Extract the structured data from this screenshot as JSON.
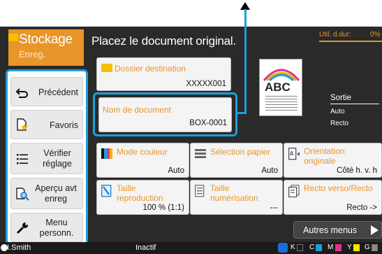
{
  "mode": {
    "title": "Stockage",
    "subtitle": "Enreg."
  },
  "side_menu": {
    "items": [
      {
        "label": "Précédent",
        "icon": "back-arrow-icon"
      },
      {
        "label": "Favoris",
        "icon": "favorite-star-icon"
      },
      {
        "label": "Vérifier réglage",
        "icon": "list-icon"
      },
      {
        "label": "Aperçu avt enreg",
        "icon": "preview-magnifier-icon"
      },
      {
        "label": "Menu personn.",
        "icon": "wrench-icon"
      }
    ]
  },
  "main": {
    "title": "Placez le document original.",
    "util_label": "Util. d.dur:",
    "util_value": "0%",
    "folder": {
      "label": "Dossier destination",
      "value": "XXXXX001",
      "icon": "folder-icon"
    },
    "doc_name": {
      "label": "Nom de document",
      "value": "BOX-0001"
    },
    "preview_text": "ABC",
    "output": {
      "title": "Sortie",
      "value1": "Auto",
      "value2": "Recto"
    },
    "settings": [
      {
        "label": "Mode couleur",
        "value": "Auto",
        "icon": "color-mode-icon"
      },
      {
        "label": "Sélection papier",
        "value": "Auto",
        "icon": "paper-tray-icon"
      },
      {
        "label": "Orientation originale",
        "value": "Côté h. v. h",
        "icon": "orientation-icon"
      },
      {
        "label": "Taille reproduction",
        "value": "100 % (1:1)",
        "icon": "reproduction-size-icon"
      },
      {
        "label": "Taille numérisation",
        "value": "---",
        "icon": "scan-size-icon"
      },
      {
        "label": "Recto verso/Recto",
        "value": "Recto ->",
        "icon": "duplex-icon"
      }
    ],
    "more_label": "Autres menus"
  },
  "status": {
    "user": "I.Smith",
    "state": "Inactif",
    "inks": [
      "K",
      "C",
      "M",
      "Y",
      "G"
    ],
    "ink_colors": [
      "#000000",
      "#1aa0dc",
      "#e0338f",
      "#f3e400",
      "#8a8a8a"
    ]
  }
}
